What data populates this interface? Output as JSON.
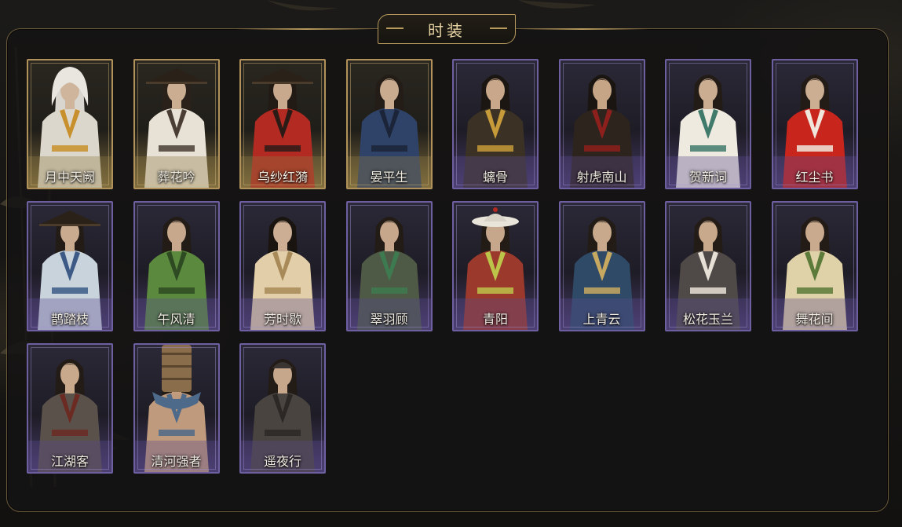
{
  "header": {
    "title": "时装"
  },
  "outfits": [
    {
      "name": "月中天阙",
      "rarity": "gold",
      "hair": "#d9d6d0",
      "hat": "hood",
      "robe": "#dcd7cc",
      "accent": "#c8902c",
      "skin": "#cfb59b"
    },
    {
      "name": "葬花吟",
      "rarity": "gold",
      "hair": "#2a211a",
      "hat": "douli",
      "robe": "#e8e2d6",
      "accent": "#4a3e34",
      "skin": "#cbae92"
    },
    {
      "name": "乌纱红漪",
      "rarity": "gold",
      "hair": "#221a14",
      "hat": "douli",
      "robe": "#b32a22",
      "accent": "#2b1b17",
      "skin": "#c9a98d"
    },
    {
      "name": "晏平生",
      "rarity": "gold",
      "hair": "#241c16",
      "hat": "none",
      "robe": "#2f4267",
      "accent": "#1b2438",
      "skin": "#c9ab90"
    },
    {
      "name": "螭骨",
      "rarity": "purple",
      "hair": "#1c1612",
      "hat": "none",
      "robe": "#3b3225",
      "accent": "#c79a3a",
      "skin": "#c8a78a"
    },
    {
      "name": "射虎南山",
      "rarity": "purple",
      "hair": "#1b1512",
      "hat": "none",
      "robe": "#2e241e",
      "accent": "#8d1f1c",
      "skin": "#c6a587"
    },
    {
      "name": "贺新词",
      "rarity": "purple",
      "hair": "#231b15",
      "hat": "none",
      "robe": "#efeae0",
      "accent": "#3f7a6a",
      "skin": "#cbad92"
    },
    {
      "name": "红尘书",
      "rarity": "purple",
      "hair": "#231b15",
      "hat": "none",
      "robe": "#c8251d",
      "accent": "#f0e6dc",
      "skin": "#ccae93"
    },
    {
      "name": "鹊踏枝",
      "rarity": "purple",
      "hair": "#231b15",
      "hat": "douli",
      "robe": "#c9d3dc",
      "accent": "#3d5a86",
      "skin": "#c9ab90"
    },
    {
      "name": "午风清",
      "rarity": "purple",
      "hair": "#231b15",
      "hat": "none",
      "robe": "#5b8a3e",
      "accent": "#2e4a22",
      "skin": "#c7a88c"
    },
    {
      "name": "芳时歇",
      "rarity": "purple",
      "hair": "#1a1410",
      "hat": "none",
      "robe": "#e2cfaa",
      "accent": "#a88a58",
      "skin": "#ccae94"
    },
    {
      "name": "翠羽顾",
      "rarity": "purple",
      "hair": "#231b15",
      "hat": "none",
      "robe": "#4e5a45",
      "accent": "#3e7a50",
      "skin": "#c6a78b"
    },
    {
      "name": "青阳",
      "rarity": "purple",
      "hair": "#231b15",
      "hat": "wide",
      "robe": "#9b3a2c",
      "accent": "#bcc44a",
      "skin": "#c6a78b"
    },
    {
      "name": "上青云",
      "rarity": "purple",
      "hair": "#231b15",
      "hat": "none",
      "robe": "#2f4a66",
      "accent": "#c7a861",
      "skin": "#c8a98c"
    },
    {
      "name": "松花玉兰",
      "rarity": "purple",
      "hair": "#231b15",
      "hat": "none",
      "robe": "#4f4a47",
      "accent": "#e6e0d6",
      "skin": "#c8a98c"
    },
    {
      "name": "舞花间",
      "rarity": "purple",
      "hair": "#231b15",
      "hat": "none",
      "robe": "#e0d2a8",
      "accent": "#5c7a3a",
      "skin": "#c9aa8e"
    },
    {
      "name": "江湖客",
      "rarity": "purple",
      "hair": "#231b15",
      "hat": "none",
      "robe": "#5a514b",
      "accent": "#6b2a22",
      "skin": "#c8a98c"
    },
    {
      "name": "清河强者",
      "rarity": "purple",
      "hair": "#231b15",
      "hat": "barrel",
      "robe": "#c09a7c",
      "accent": "#4e6a8a",
      "skin": "#c49c7e"
    },
    {
      "name": "遥夜行",
      "rarity": "purple",
      "hair": "#231b15",
      "hat": "cap",
      "robe": "#4a4440",
      "accent": "#2c2826",
      "skin": "#c6a78b"
    }
  ]
}
